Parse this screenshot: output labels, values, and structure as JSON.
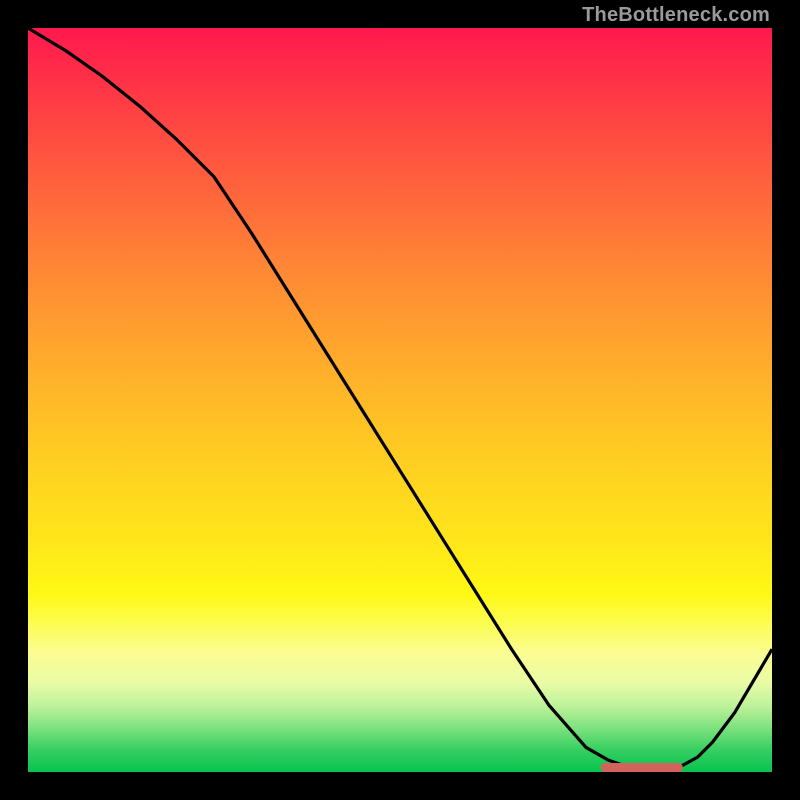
{
  "watermark": "TheBottleneck.com",
  "colors": {
    "curve": "#000000",
    "marker": "#d1635d",
    "background_frame": "#000000"
  },
  "curve_stroke_width": 3.2,
  "chart_data": {
    "type": "line",
    "title": "",
    "xlabel": "",
    "ylabel": "",
    "xlim": [
      0,
      100
    ],
    "ylim": [
      0,
      100
    ],
    "x": [
      0,
      5,
      10,
      15,
      20,
      25,
      30,
      35,
      40,
      45,
      50,
      55,
      60,
      65,
      70,
      75,
      78,
      80,
      82,
      85,
      88,
      90,
      92,
      95,
      100
    ],
    "values": [
      100,
      97,
      93.5,
      89.5,
      85,
      80,
      72.5,
      64.5,
      56.5,
      48.5,
      40.5,
      32.5,
      24.5,
      16.5,
      9,
      3.3,
      1.6,
      0.9,
      0.6,
      0.5,
      0.9,
      2.0,
      4.0,
      8.0,
      16.5
    ],
    "flat_bottom_marker": {
      "x_start": 77,
      "x_end": 88,
      "y": 0.6,
      "color": "#d1635d"
    },
    "gradient_stops": [
      {
        "pos": 0,
        "color": "#ff184e"
      },
      {
        "pos": 8,
        "color": "#ff3546"
      },
      {
        "pos": 20,
        "color": "#ff5e3e"
      },
      {
        "pos": 32,
        "color": "#ff8635"
      },
      {
        "pos": 44,
        "color": "#ffa92c"
      },
      {
        "pos": 56,
        "color": "#ffc923"
      },
      {
        "pos": 68,
        "color": "#ffe41b"
      },
      {
        "pos": 76,
        "color": "#fff815"
      },
      {
        "pos": 80,
        "color": "#fcfd50"
      },
      {
        "pos": 84,
        "color": "#fbfd92"
      },
      {
        "pos": 88,
        "color": "#e9fba5"
      },
      {
        "pos": 91,
        "color": "#c0f39b"
      },
      {
        "pos": 94,
        "color": "#7fe27f"
      },
      {
        "pos": 97,
        "color": "#37cf62"
      },
      {
        "pos": 100,
        "color": "#06c34e"
      }
    ]
  }
}
